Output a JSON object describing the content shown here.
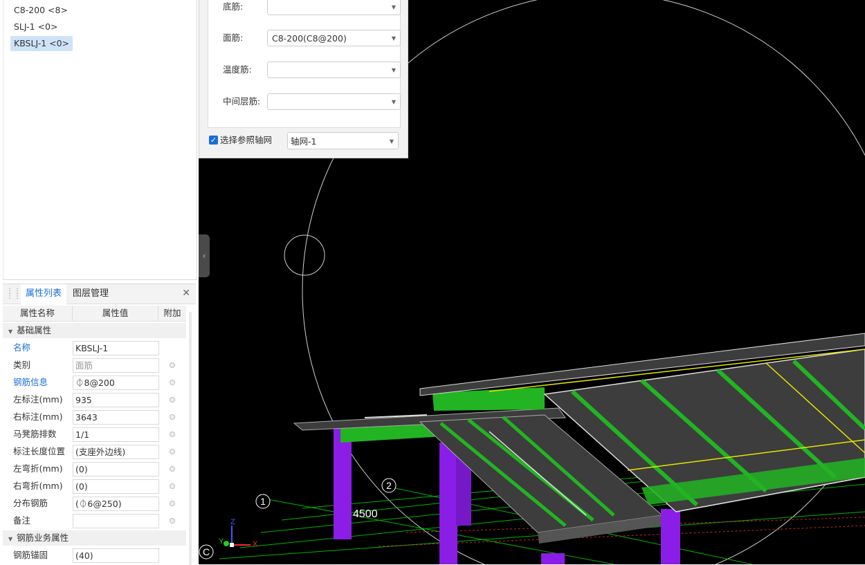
{
  "tree": {
    "items": [
      {
        "label": "C8-200 <8>",
        "selected": false
      },
      {
        "label": "SLJ-1 <0>",
        "selected": false
      },
      {
        "label": "KBSLJ-1 <0>",
        "selected": true
      }
    ]
  },
  "dialog": {
    "fields": [
      {
        "label": "底筋:",
        "value": ""
      },
      {
        "label": "面筋:",
        "value": "C8-200(C8@200)"
      },
      {
        "label": "温度筋:",
        "value": ""
      },
      {
        "label": "中间层筋:",
        "value": ""
      }
    ],
    "checkbox_label": "选择参照轴网",
    "checkbox_checked": true,
    "axis_value": "轴网-1"
  },
  "property_panel": {
    "tabs": [
      "属性列表",
      "图层管理"
    ],
    "active_tab": "属性列表",
    "columns": [
      "属性名称",
      "属性值",
      "附加"
    ],
    "groups": [
      {
        "title": "基础属性",
        "rows": [
          {
            "name": "名称",
            "value": "KBSLJ-1",
            "blue": true
          },
          {
            "name": "类别",
            "value": "面筋",
            "disabled": true
          },
          {
            "name": "钢筋信息",
            "value": "⏀8@200",
            "blue": true
          },
          {
            "name": "左标注(mm)",
            "value": "935"
          },
          {
            "name": "右标注(mm)",
            "value": "3643"
          },
          {
            "name": "马凳筋排数",
            "value": "1/1"
          },
          {
            "name": "标注长度位置",
            "value": "(支座外边线)"
          },
          {
            "name": "左弯折(mm)",
            "value": "(0)"
          },
          {
            "name": "右弯折(mm)",
            "value": "(0)"
          },
          {
            "name": "分布钢筋",
            "value": "(⏀6@250)"
          },
          {
            "name": "备注",
            "value": ""
          }
        ]
      },
      {
        "title": "钢筋业务属性",
        "rows": [
          {
            "name": "钢筋锚固",
            "value": "(40)"
          }
        ]
      }
    ]
  },
  "viewport": {
    "axis_labels": [
      "1",
      "2",
      "C"
    ],
    "dimension_label": "4500",
    "gizmo_axes": [
      "X",
      "Y",
      "Z"
    ],
    "colors": {
      "slab": "#3d3d3d",
      "beam": "#22b422",
      "column": "#8a1ee6",
      "rebar_line": "#e6e600",
      "grid_line": "#00c800",
      "background": "#000000"
    }
  }
}
